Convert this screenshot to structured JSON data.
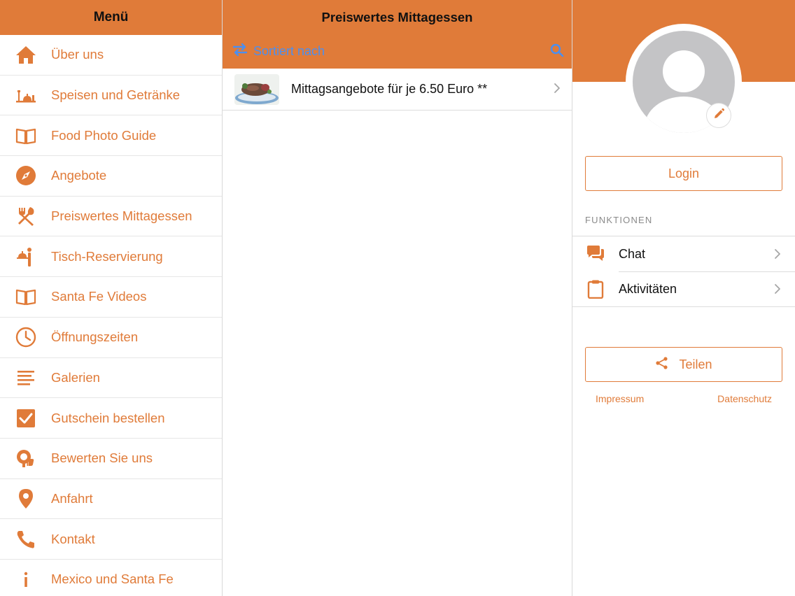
{
  "colors": {
    "accent": "#e07b39",
    "link_blue": "#4b8ff0"
  },
  "menu": {
    "title": "Menü",
    "items": [
      {
        "label": "Über uns",
        "icon": "home-icon"
      },
      {
        "label": "Speisen und Getränke",
        "icon": "dining-icon"
      },
      {
        "label": "Food Photo Guide",
        "icon": "book-icon"
      },
      {
        "label": "Angebote",
        "icon": "compass-icon"
      },
      {
        "label": "Preiswertes Mittagessen",
        "icon": "cutlery-icon"
      },
      {
        "label": "Tisch-Reservierung",
        "icon": "reception-icon"
      },
      {
        "label": "Santa Fe Videos",
        "icon": "book-icon"
      },
      {
        "label": "Öffnungszeiten",
        "icon": "clock-icon"
      },
      {
        "label": "Galerien",
        "icon": "lines-icon"
      },
      {
        "label": "Gutschein bestellen",
        "icon": "checkbox-icon"
      },
      {
        "label": "Bewerten Sie uns",
        "icon": "thumbs-up-icon"
      },
      {
        "label": "Anfahrt",
        "icon": "map-pin-icon"
      },
      {
        "label": "Kontakt",
        "icon": "phone-icon"
      },
      {
        "label": "Mexico und Santa Fe",
        "icon": "info-icon"
      }
    ]
  },
  "middle": {
    "title": "Preiswertes Mittagessen",
    "sort_label": "Sortiert nach",
    "items": [
      {
        "label": "Mittagsangebote für je 6.50 Euro **"
      }
    ]
  },
  "profile": {
    "login_label": "Login",
    "section_label": "FUNKTIONEN",
    "functions": [
      {
        "label": "Chat",
        "icon": "chat-icon"
      },
      {
        "label": "Aktivitäten",
        "icon": "clipboard-icon"
      }
    ],
    "share_label": "Teilen",
    "impressum_label": "Impressum",
    "datenschutz_label": "Datenschutz"
  }
}
